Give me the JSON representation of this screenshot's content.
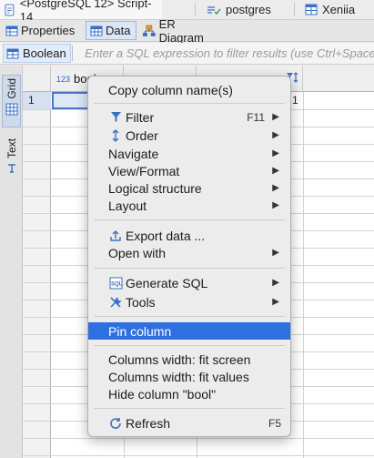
{
  "editor_tabs": [
    {
      "label": "<PostgreSQL 12> Script-14",
      "icon": "script-icon"
    },
    {
      "label": "postgres",
      "icon": "database-check-icon"
    },
    {
      "label": "Xeniia",
      "icon": "table-icon"
    }
  ],
  "result_tabs": [
    {
      "label": "Properties",
      "icon": "properties-icon"
    },
    {
      "label": "Data",
      "icon": "data-grid-icon",
      "active": true
    },
    {
      "label": "ER Diagram",
      "icon": "er-diagram-icon"
    }
  ],
  "filter_bar": {
    "table_label": "Boolean",
    "placeholder": "Enter a SQL expression to filter results (use Ctrl+Space)"
  },
  "side_tabs": [
    {
      "label": "Grid",
      "icon": "grid-icon",
      "active": true
    },
    {
      "label": "Text",
      "icon": "text-icon"
    }
  ],
  "grid": {
    "columns": [
      {
        "type_badge": "123",
        "name": "bool"
      },
      {
        "type_badge": "",
        "name": ""
      },
      {
        "type_badge": "",
        "name": ""
      }
    ],
    "rows": [
      {
        "num": "1",
        "last_cell": "1"
      }
    ]
  },
  "context_menu": {
    "items": [
      {
        "label": "Copy column name(s)"
      },
      {
        "label": "Filter",
        "icon": "filter-icon",
        "shortcut": "F11",
        "submenu": true
      },
      {
        "label": "Order",
        "icon": "sort-icon",
        "submenu": true
      },
      {
        "label": "Navigate",
        "submenu": true
      },
      {
        "label": "View/Format",
        "submenu": true
      },
      {
        "label": "Logical structure",
        "submenu": true
      },
      {
        "label": "Layout",
        "submenu": true
      },
      {
        "label": "Export data ...",
        "icon": "export-icon"
      },
      {
        "label": "Open with",
        "submenu": true
      },
      {
        "label": "Generate SQL",
        "icon": "sql-icon",
        "submenu": true
      },
      {
        "label": "Tools",
        "icon": "tools-icon",
        "submenu": true
      },
      {
        "label": "Pin column",
        "highlighted": true
      },
      {
        "label": "Columns width: fit screen"
      },
      {
        "label": "Columns width: fit values"
      },
      {
        "label": "Hide column \"bool\""
      },
      {
        "label": "Refresh",
        "icon": "refresh-icon",
        "shortcut": "F5"
      }
    ]
  },
  "colors": {
    "accent": "#2f70e0",
    "selection_border": "#4c77c9",
    "menu_background": "#ececec"
  }
}
